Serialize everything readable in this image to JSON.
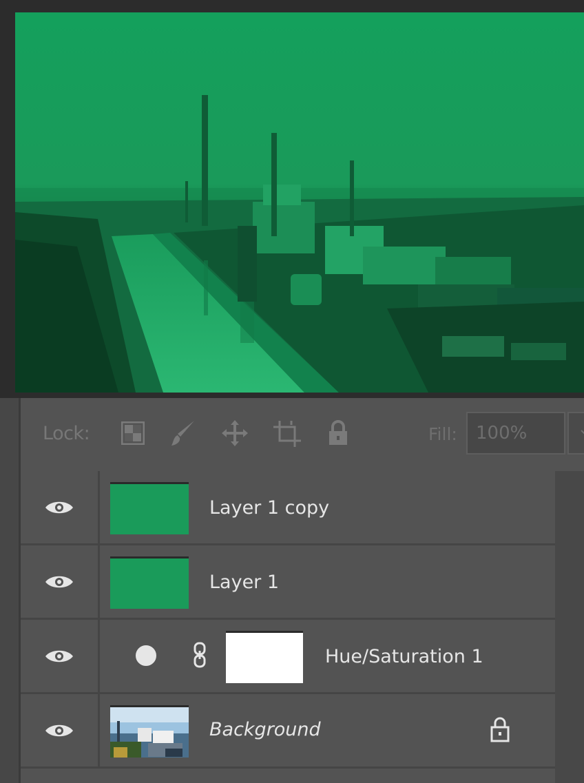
{
  "canvas": {
    "photo_description_icon": "industrial-power-plant-photo"
  },
  "toolbar": {
    "lock_label": "Lock:",
    "fill_label": "Fill:",
    "fill_value": "100%",
    "tools": [
      {
        "name": "lock-transparent-pixels-icon"
      },
      {
        "name": "lock-image-pixels-icon"
      },
      {
        "name": "lock-position-icon"
      },
      {
        "name": "lock-artboard-icon"
      },
      {
        "name": "lock-all-icon"
      }
    ]
  },
  "layers": [
    {
      "name": "Layer 1 copy",
      "visible": true,
      "thumbnail": "green-fill",
      "color": "#1a9b5a"
    },
    {
      "name": "Layer 1",
      "visible": true,
      "thumbnail": "green-fill",
      "color": "#1a9b5a"
    },
    {
      "name": "Hue/Saturation 1",
      "visible": true,
      "thumbnail": "white-mask",
      "adjustment": true
    },
    {
      "name": "Background",
      "visible": true,
      "thumbnail": "city-photo",
      "locked": true
    }
  ],
  "colors": {
    "panel_bg": "#535353",
    "layer_green": "#1a9b5a",
    "text": "#e6e6e6"
  }
}
